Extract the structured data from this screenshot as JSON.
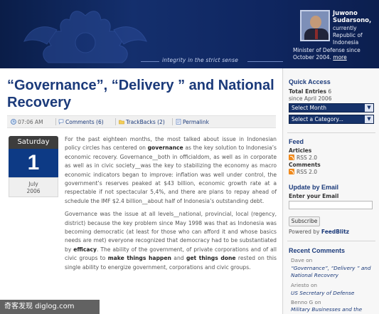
{
  "header": {
    "tagline": "integrity in the strict sense",
    "profile_name": "Juwono Sudarsono,",
    "profile_line1": "currently Republic of Indonesia",
    "profile_line2": "Minister of Defense since October 2004.",
    "profile_more": "more"
  },
  "post": {
    "title": "“Governance”, “Delivery ” and National Recovery",
    "time": "07:06 AM",
    "comments": "Comments (6)",
    "trackbacks": "TrackBacks (2)",
    "permalink": "Permalink",
    "date_day": "Saturday",
    "date_num": "1",
    "date_month": "July",
    "date_year": "2006",
    "p1_a": "For the past eighteen months, the most talked about issue in Indonesian policy circles has centered on",
    "p1_b": "governance",
    "p1_c": "as the key solution to Indonesia’s economic recovery. Governance__both in officialdom, as well as in corporate as well as in civic society__was the key to stabilizing the economy as macro economic indicators began to improve: inflation was well under control, the government’s reserves peaked at $43 billion, economic growth rate at a respectable if not spectacular 5,4%, and there are plans to repay ahead of schedule the IMF $2.4 billion__about half of Indonesia’s outstanding debt.",
    "p2_a": "Governance was the issue at all levels__national, provincial, local (regency, district) because the key problem since May 1998 was that as Indonesia was becoming democratic (at least for those who can afford it and whose basics needs are met) everyone recognized that democracy had to be substantiated by",
    "p2_b": "efficacy",
    "p2_c": ". The ability of the government, of private corporations and of all civic groups to",
    "p2_d": "make things happen",
    "p2_e": "and",
    "p2_f": "get things done",
    "p2_g": "rested on this single ability to energize government, corporations and civic groups."
  },
  "sidebar": {
    "quick_access": "Quick Access",
    "total_entries_label": "Total Entries",
    "total_entries_value": "6",
    "since": "since April 2006",
    "select_month": "Select Month",
    "select_category": "Select a Category...",
    "feed": "Feed",
    "articles": "Articles",
    "rss1": "RSS 2.0",
    "comments_label": "Comments",
    "rss2": "RSS 2.0",
    "update_by_email": "Update by Email",
    "enter_email": "Enter your Email",
    "subscribe": "Subscribe",
    "powered_by": "Powered by",
    "feedblitz": "FeedBlitz",
    "recent_comments": "Recent Comments",
    "recent": [
      {
        "name": "Dave on",
        "link": "“Governance”, “Delivery ” and National Recovery"
      },
      {
        "name": "Ariesto on",
        "link": "US Secretary of Defense"
      },
      {
        "name": "Benno G on",
        "link": "Military Businesses and the"
      }
    ]
  },
  "watermark": "奇客发现 diglog.com"
}
